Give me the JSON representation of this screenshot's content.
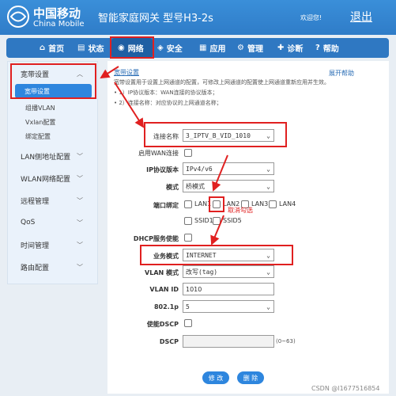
{
  "header": {
    "brand_cn": "中国移动",
    "brand_en": "China Mobile",
    "product_title": "智能家庭网关 型号H3-2s",
    "welcome": "欢迎您!",
    "logout": "退出"
  },
  "nav": {
    "tabs": [
      {
        "label": "首页",
        "icon": "home-icon"
      },
      {
        "label": "状态",
        "icon": "status-icon"
      },
      {
        "label": "网络",
        "icon": "wifi-icon"
      },
      {
        "label": "安全",
        "icon": "shield-icon"
      },
      {
        "label": "应用",
        "icon": "apps-icon"
      },
      {
        "label": "管理",
        "icon": "gear-icon"
      },
      {
        "label": "诊断",
        "icon": "diagnose-icon"
      },
      {
        "label": "帮助",
        "icon": "help-icon"
      }
    ],
    "active": "网络"
  },
  "sidebar": {
    "groups": [
      {
        "label": "宽带设置"
      },
      {
        "label": "LAN侧地址配置"
      },
      {
        "label": "WLAN网络配置"
      },
      {
        "label": "远程管理"
      },
      {
        "label": "QoS"
      },
      {
        "label": "时间管理"
      },
      {
        "label": "路由配置"
      }
    ],
    "subitems": [
      {
        "label": "宽带设置"
      },
      {
        "label": "组播VLAN"
      },
      {
        "label": "Vxlan配置"
      },
      {
        "label": "绑定配置"
      }
    ]
  },
  "content": {
    "breadcrumb": "宽带设置",
    "help": "展开帮助",
    "desc": [
      "宽带设置用于设置上网通道的配置，可修改上网通道的配置使上网通道重新应用并生效。",
      "• 1）IP协议版本：WAN连接的协议版本；",
      "• 2）连接名称：对应协议的上网通道名称；"
    ],
    "form": {
      "conn_name_label": "连接名称",
      "conn_name_value": "3_IPTV_B_VID_1010",
      "enable_wan_label": "启用WAN连接",
      "ip_version_label": "IP协议版本",
      "ip_version_value": "IPv4/v6",
      "mode_label": "模式",
      "mode_value": "桥模式",
      "port_bind_label": "端口绑定",
      "ports": [
        "LAN1",
        "LAN2",
        "LAN3",
        "LAN4",
        "SSID1",
        "SSID5"
      ],
      "port_hint": "取消勾选",
      "dhcp_label": "DHCP服务使能",
      "service_mode_label": "业务模式",
      "service_mode_value": "INTERNET",
      "vlan_mode_label": "VLAN 模式",
      "vlan_mode_value": "改写(tag)",
      "vlan_id_label": "VLAN ID",
      "vlan_id_value": "1010",
      "p8021_label": "802.1p",
      "p8021_value": "5",
      "dscp_enable_label": "使能DSCP",
      "dscp_label": "DSCP",
      "dscp_value": "",
      "dscp_range": "(0~63)"
    },
    "buttons": {
      "modify": "修 改",
      "delete": "删 除"
    }
  },
  "watermark": "CSDN @l1677516854",
  "colors": {
    "primary": "#2f78c2",
    "accent": "#2e86de",
    "annotation": "#e02020"
  }
}
